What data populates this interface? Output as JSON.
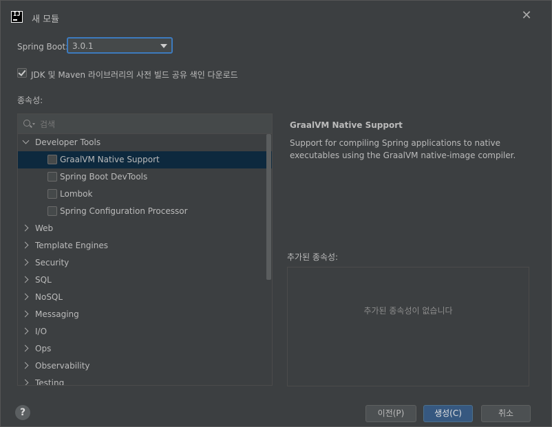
{
  "window": {
    "title": "새 모듈"
  },
  "spring_boot": {
    "label": "Spring Boot:",
    "selected": "3.0.1"
  },
  "download_index": {
    "label": "JDK 및 Maven 라이브러리의 사전 빌드 공유 색인 다운로드",
    "checked": true
  },
  "dependencies": {
    "label": "종속성:",
    "search_placeholder": "검색",
    "groups": [
      {
        "name": "Developer Tools",
        "expanded": true,
        "items": [
          {
            "label": "GraalVM Native Support",
            "checked": false,
            "selected": true
          },
          {
            "label": "Spring Boot DevTools",
            "checked": false
          },
          {
            "label": "Lombok",
            "checked": false
          },
          {
            "label": "Spring Configuration Processor",
            "checked": false
          }
        ]
      },
      {
        "name": "Web"
      },
      {
        "name": "Template Engines"
      },
      {
        "name": "Security"
      },
      {
        "name": "SQL"
      },
      {
        "name": "NoSQL"
      },
      {
        "name": "Messaging"
      },
      {
        "name": "I/O"
      },
      {
        "name": "Ops"
      },
      {
        "name": "Observability"
      },
      {
        "name": "Testing"
      }
    ]
  },
  "detail": {
    "title": "GraalVM Native Support",
    "description": "Support for compiling Spring applications to native executables using the GraalVM native-image compiler."
  },
  "added": {
    "label": "추가된 종속성:",
    "empty_text": "추가된 종속성이 없습니다"
  },
  "buttons": {
    "help": "?",
    "previous": "이전(P)",
    "create": "생성(C)",
    "cancel": "취소"
  },
  "colors": {
    "background": "#3c3f41",
    "selection": "#0d293e",
    "primary_button": "#365880",
    "focus_border": "#3d7bbf"
  }
}
